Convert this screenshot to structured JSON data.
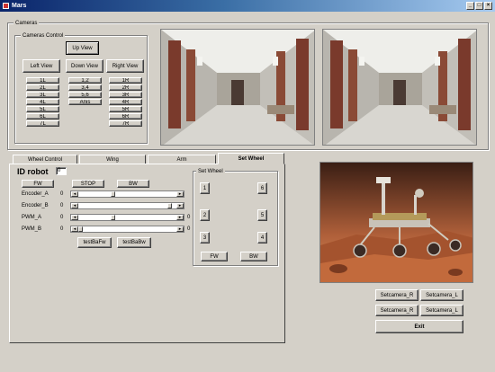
{
  "window": {
    "title": "Mars"
  },
  "cameras": {
    "group_label": "Cameras",
    "control_label": "Cameras Control",
    "up_view": "Up View",
    "left_view": "Left View",
    "down_view": "Down View",
    "right_view": "Right View",
    "left_column": [
      "1L",
      "2L",
      "3L",
      "4L",
      "5L",
      "6L",
      "7L"
    ],
    "center_column": [
      "1,2",
      "3,4",
      "5,6",
      "Anis"
    ],
    "right_column": [
      "1R",
      "2R",
      "3R",
      "4R",
      "5R",
      "6R",
      "7R"
    ]
  },
  "tabs": [
    {
      "label": "Wheel Control"
    },
    {
      "label": "Wing"
    },
    {
      "label": "Arm"
    },
    {
      "label": "Set Wheel"
    }
  ],
  "robot": {
    "id_label": "ID  robot",
    "id_value": "0",
    "fw_label": "FW",
    "stop_label": "STOP",
    "bw_label": "BW",
    "rows": [
      {
        "label": "Encoder_A",
        "value": "0",
        "right_value": "",
        "position": 0.35
      },
      {
        "label": "Encoder_B",
        "value": "0",
        "right_value": "",
        "position": 0.95
      },
      {
        "label": "PWM_A",
        "value": "0",
        "right_value": "0",
        "position": 0.35
      },
      {
        "label": "PWM_B",
        "value": "0",
        "right_value": "0",
        "position": 0.0
      }
    ],
    "bottom_buttons": [
      "testBaFw",
      "testBaBw"
    ]
  },
  "set_wheel": {
    "label": "Set Wheel",
    "buttons": [
      "1",
      "6",
      "2",
      "5",
      "3",
      "4"
    ],
    "fw_label": "FW",
    "bw_label": "BW"
  },
  "right_panel": {
    "buttons_row1": [
      "Setcamera_R",
      "Setcamera_L"
    ],
    "buttons_row2": [
      "Setcamera_R",
      "Setcamera_L"
    ],
    "exit_label": "Exit"
  }
}
